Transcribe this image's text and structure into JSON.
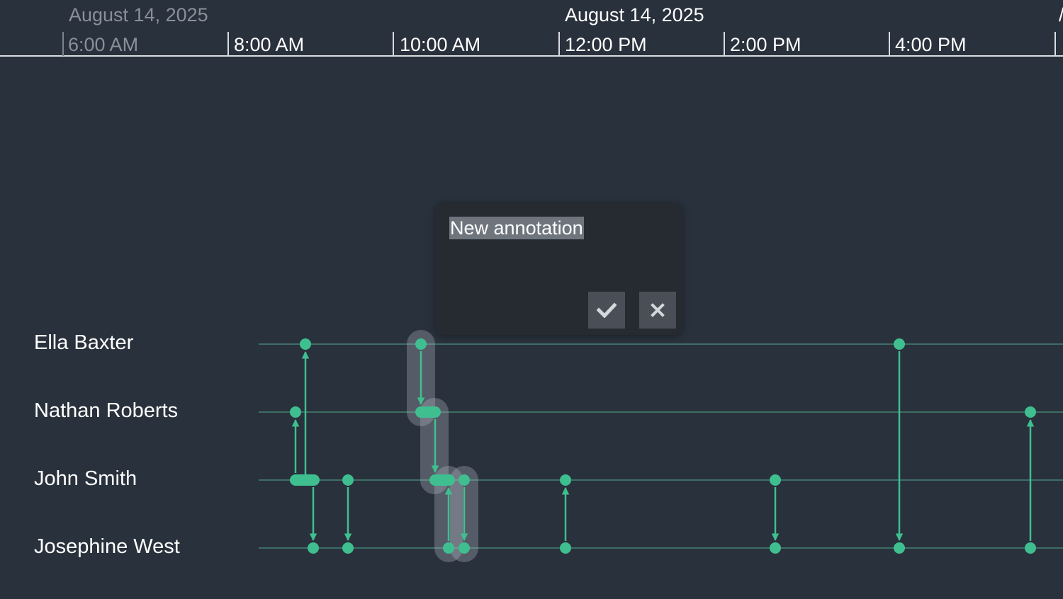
{
  "header": {
    "dates": [
      {
        "label": "August 14, 2025",
        "dim": true
      },
      {
        "label": "August 14, 2025",
        "dim": false
      }
    ],
    "ticks": [
      {
        "label": "6:00 AM",
        "dim": true
      },
      {
        "label": "8:00 AM",
        "dim": false
      },
      {
        "label": "10:00 AM",
        "dim": false
      },
      {
        "label": "12:00 PM",
        "dim": false
      },
      {
        "label": "2:00 PM",
        "dim": false
      },
      {
        "label": "4:00 PM",
        "dim": false
      }
    ]
  },
  "rows": [
    {
      "label": "Ella Baxter"
    },
    {
      "label": "Nathan Roberts"
    },
    {
      "label": "John Smith"
    },
    {
      "label": "Josephine West"
    }
  ],
  "annotation": {
    "text": "New annotation",
    "confirm_icon": "check-icon",
    "cancel_icon": "close-icon"
  },
  "colors": {
    "background": "#29313c",
    "event": "#3fbf8f",
    "row_line": "#3d6e66",
    "highlight": "rgba(180,185,195,0.35)",
    "axis": "#d9dde2"
  }
}
